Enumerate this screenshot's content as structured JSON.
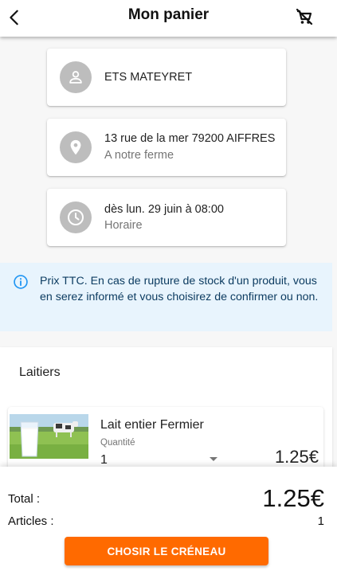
{
  "header": {
    "title": "Mon panier",
    "back_icon": "arrow-back-icon",
    "cart_icon": "remove-shopping-cart-icon"
  },
  "producer": {
    "name": "ETS MATEYRET",
    "icon": "person-icon"
  },
  "location": {
    "address": "13 rue de la mer 79200 AIFFRES",
    "label": "A notre ferme",
    "icon": "location-pin-icon"
  },
  "schedule": {
    "date": "dès lun. 29 juin à 08:00",
    "label": "Horaire",
    "icon": "clock-icon"
  },
  "info": {
    "text": "Prix TTC. En cas de rupture de stock d'un produit, vous en serez informé et vous choisirez de confirmer ou non.",
    "icon": "info-icon"
  },
  "section": {
    "title": "Laitiers",
    "items": [
      {
        "name": "Lait entier Fermier",
        "quantity_label": "Quantité",
        "quantity": "1",
        "price": "1.25€"
      }
    ]
  },
  "summary": {
    "total_label": "Total :",
    "total_value": "1.25€",
    "articles_label": "Articles :",
    "articles_value": "1",
    "cta_label": "CHOSIR LE CRÉNEAU"
  },
  "colors": {
    "accent": "#ff6a00",
    "info_background": "#e8f4fd",
    "info_text": "#0d3c61",
    "avatar": "#bdbdbd"
  }
}
